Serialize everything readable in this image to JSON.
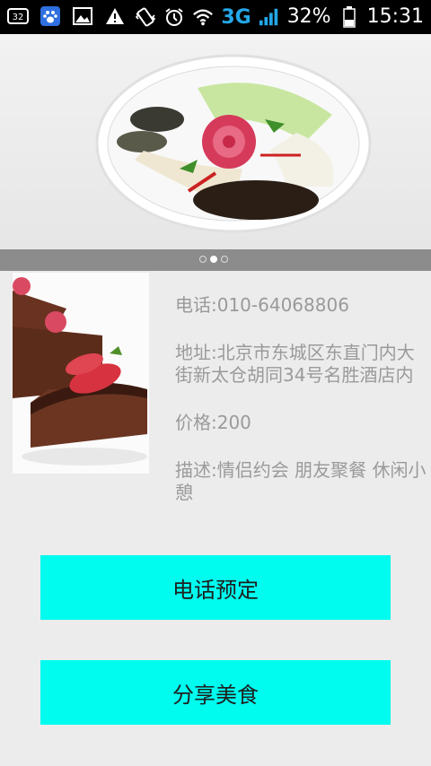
{
  "status_bar": {
    "notification_count": "32",
    "network": "3G",
    "battery": "32%",
    "time": "15:31",
    "icons": [
      "notification-count-icon",
      "baidu-paw-icon",
      "image-icon",
      "warning-icon",
      "vibrate-icon",
      "alarm-icon",
      "wifi-icon",
      "signal-icon",
      "battery-icon"
    ]
  },
  "banner": {
    "image": "cold-dish-platter",
    "dots": 3,
    "active_dot": 1
  },
  "detail": {
    "image": "chocolate-cake",
    "phone": "电话:010-64068806",
    "address": "地址:北京市东城区东直门内大街新太仓胡同34号名胜酒店内",
    "price": "价格:200",
    "description": "描述:情侣约会 朋友聚餐 休闲小憩"
  },
  "buttons": {
    "book": "电话预定",
    "share": "分享美食"
  },
  "colors": {
    "button_bg": "#00fbef",
    "info_text": "#9a9a9a",
    "page_bg": "#ececec"
  }
}
